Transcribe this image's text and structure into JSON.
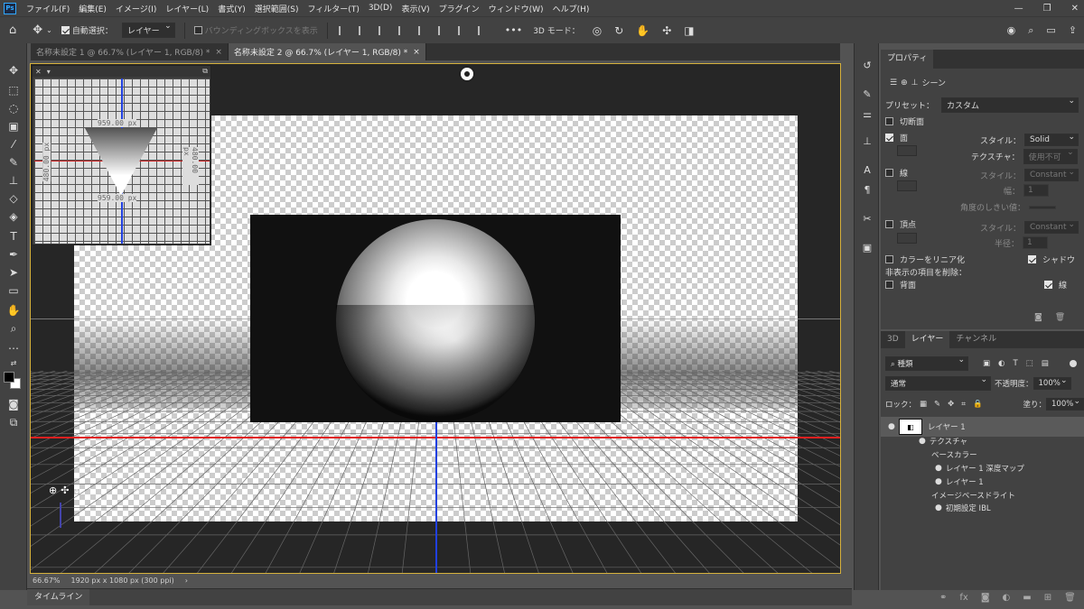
{
  "app": {
    "logo": "Ps"
  },
  "menu": [
    "ファイル(F)",
    "編集(E)",
    "イメージ(I)",
    "レイヤー(L)",
    "書式(Y)",
    "選択範囲(S)",
    "フィルター(T)",
    "3D(D)",
    "表示(V)",
    "プラグイン",
    "ウィンドウ(W)",
    "ヘルプ(H)"
  ],
  "window_controls": [
    "—",
    "❐",
    "✕"
  ],
  "options": {
    "auto_select_label": "自動選択：",
    "auto_select_value": "レイヤー",
    "bbox_label": "バウンディングボックスを表示",
    "mode3d_label": "3D モード：",
    "more": "•••"
  },
  "tabs": [
    {
      "label": "名称未設定 1 @ 66.7% (レイヤー 1, RGB/8) *",
      "close": "×"
    },
    {
      "label": "名称未設定 2 @ 66.7% (レイヤー 1, RGB/8) *",
      "close": "×"
    }
  ],
  "secondary_view": {
    "labels": {
      "top": "959.00 px",
      "bottom": "959.00 px",
      "left": "480.00 px",
      "right": "480.00 px"
    }
  },
  "status": {
    "zoom": "66.67%",
    "doc_info": "1920 px x 1080 px (300 ppi)",
    "arrow": "›"
  },
  "timeline": {
    "label": "タイムライン"
  },
  "properties": {
    "tab": "プロパティ",
    "scene_label": "シーン",
    "preset_label": "プリセット：",
    "preset_value": "カスタム",
    "cross_section": "切断面",
    "face": "面",
    "style_label": "スタイル：",
    "face_style": "Solid",
    "texture_label": "テクスチャ：",
    "texture_value": "使用不可",
    "line": "線",
    "line_style": "Constant",
    "width_label": "幅：",
    "width_value": "1",
    "angle_label": "角度のしきい値：",
    "vertex": "頂点",
    "vertex_style": "Constant",
    "radius_label": "半径：",
    "radius_value": "1",
    "linearize": "カラーをリニア化",
    "shadow": "シャドウ",
    "hidden_remove": "非表示の項目を削除：",
    "back": "背面",
    "line2": "線"
  },
  "layers": {
    "tabs": [
      "3D",
      "レイヤー",
      "チャンネル"
    ],
    "filter_label": "種類",
    "blend_mode": "通常",
    "opacity_label": "不透明度：",
    "opacity_value": "100%",
    "lock_label": "ロック：",
    "fill_label": "塗り：",
    "fill_value": "100%",
    "items": [
      {
        "name": "レイヤー 1"
      },
      {
        "name": "テクスチャ"
      },
      {
        "name": "ベースカラー"
      },
      {
        "name": "レイヤー 1 深度マップ"
      },
      {
        "name": "レイヤー 1"
      },
      {
        "name": "イメージベースドライト"
      },
      {
        "name": "初期設定 IBL"
      }
    ]
  },
  "footer_icons": [
    "link-icon",
    "fx-icon",
    "mask-icon",
    "adjustment-icon",
    "group-icon",
    "new-layer-icon",
    "trash-icon"
  ],
  "colors": {
    "accent_border": "#d6b13c",
    "red_guide": "#e02020",
    "blue_guide": "#2040e0"
  }
}
